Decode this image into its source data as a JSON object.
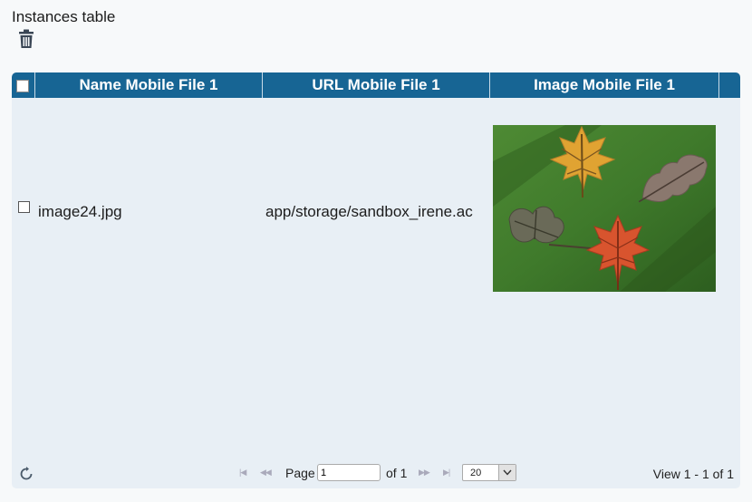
{
  "page": {
    "title": "Instances table"
  },
  "table": {
    "columns": [
      "Name Mobile File 1",
      "URL Mobile File 1",
      "Image Mobile File 1"
    ],
    "rows": [
      {
        "name": "image24.jpg",
        "url": "app/storage/sandbox_irene.ac"
      }
    ]
  },
  "pager": {
    "page_label": "Page",
    "page_value": "1",
    "of_label": "of 1",
    "page_size": "20",
    "view_text": "View 1 - 1 of 1"
  },
  "colors": {
    "header": "#176594",
    "body": "#e8eff5"
  },
  "icons": {
    "toolbar": "trash-icon",
    "refresh": "refresh-icon",
    "nav": [
      "first-page-icon",
      "prev-page-icon",
      "next-page-icon",
      "last-page-icon"
    ]
  }
}
